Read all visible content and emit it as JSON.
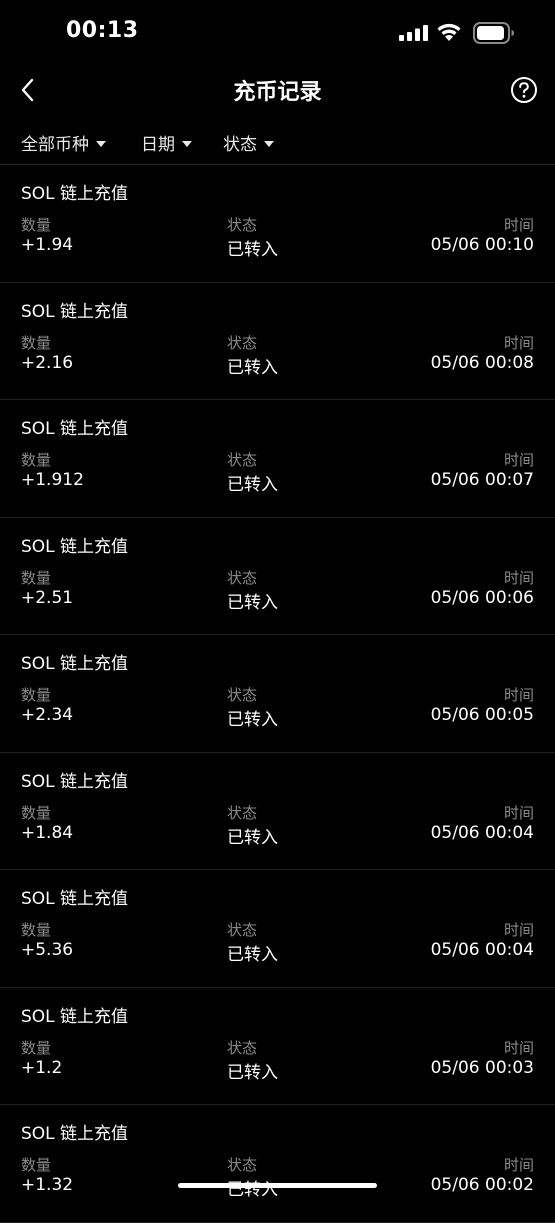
{
  "status_bar": {
    "time": "00:13"
  },
  "nav": {
    "title": "充币记录",
    "back_icon": "chevron-left-icon",
    "help_icon": "question-circle-icon"
  },
  "filters": {
    "coin": "全部币种",
    "date": "日期",
    "status": "状态"
  },
  "labels": {
    "amount": "数量",
    "status": "状态",
    "time": "时间"
  },
  "records": [
    {
      "title": "SOL 链上充值",
      "amount": "+1.94",
      "status": "已转入",
      "time": "05/06 00:10"
    },
    {
      "title": "SOL 链上充值",
      "amount": "+2.16",
      "status": "已转入",
      "time": "05/06 00:08"
    },
    {
      "title": "SOL 链上充值",
      "amount": "+1.912",
      "status": "已转入",
      "time": "05/06 00:07"
    },
    {
      "title": "SOL 链上充值",
      "amount": "+2.51",
      "status": "已转入",
      "time": "05/06 00:06"
    },
    {
      "title": "SOL 链上充值",
      "amount": "+2.34",
      "status": "已转入",
      "time": "05/06 00:05"
    },
    {
      "title": "SOL 链上充值",
      "amount": "+1.84",
      "status": "已转入",
      "time": "05/06 00:04"
    },
    {
      "title": "SOL 链上充值",
      "amount": "+5.36",
      "status": "已转入",
      "time": "05/06 00:04"
    },
    {
      "title": "SOL 链上充值",
      "amount": "+1.2",
      "status": "已转入",
      "time": "05/06 00:03"
    },
    {
      "title": "SOL 链上充值",
      "amount": "+1.32",
      "status": "已转入",
      "time": "05/06 00:02"
    }
  ],
  "colors": {
    "background": "#000000",
    "text_primary": "#ffffff",
    "text_secondary": "#8a8a8a"
  }
}
